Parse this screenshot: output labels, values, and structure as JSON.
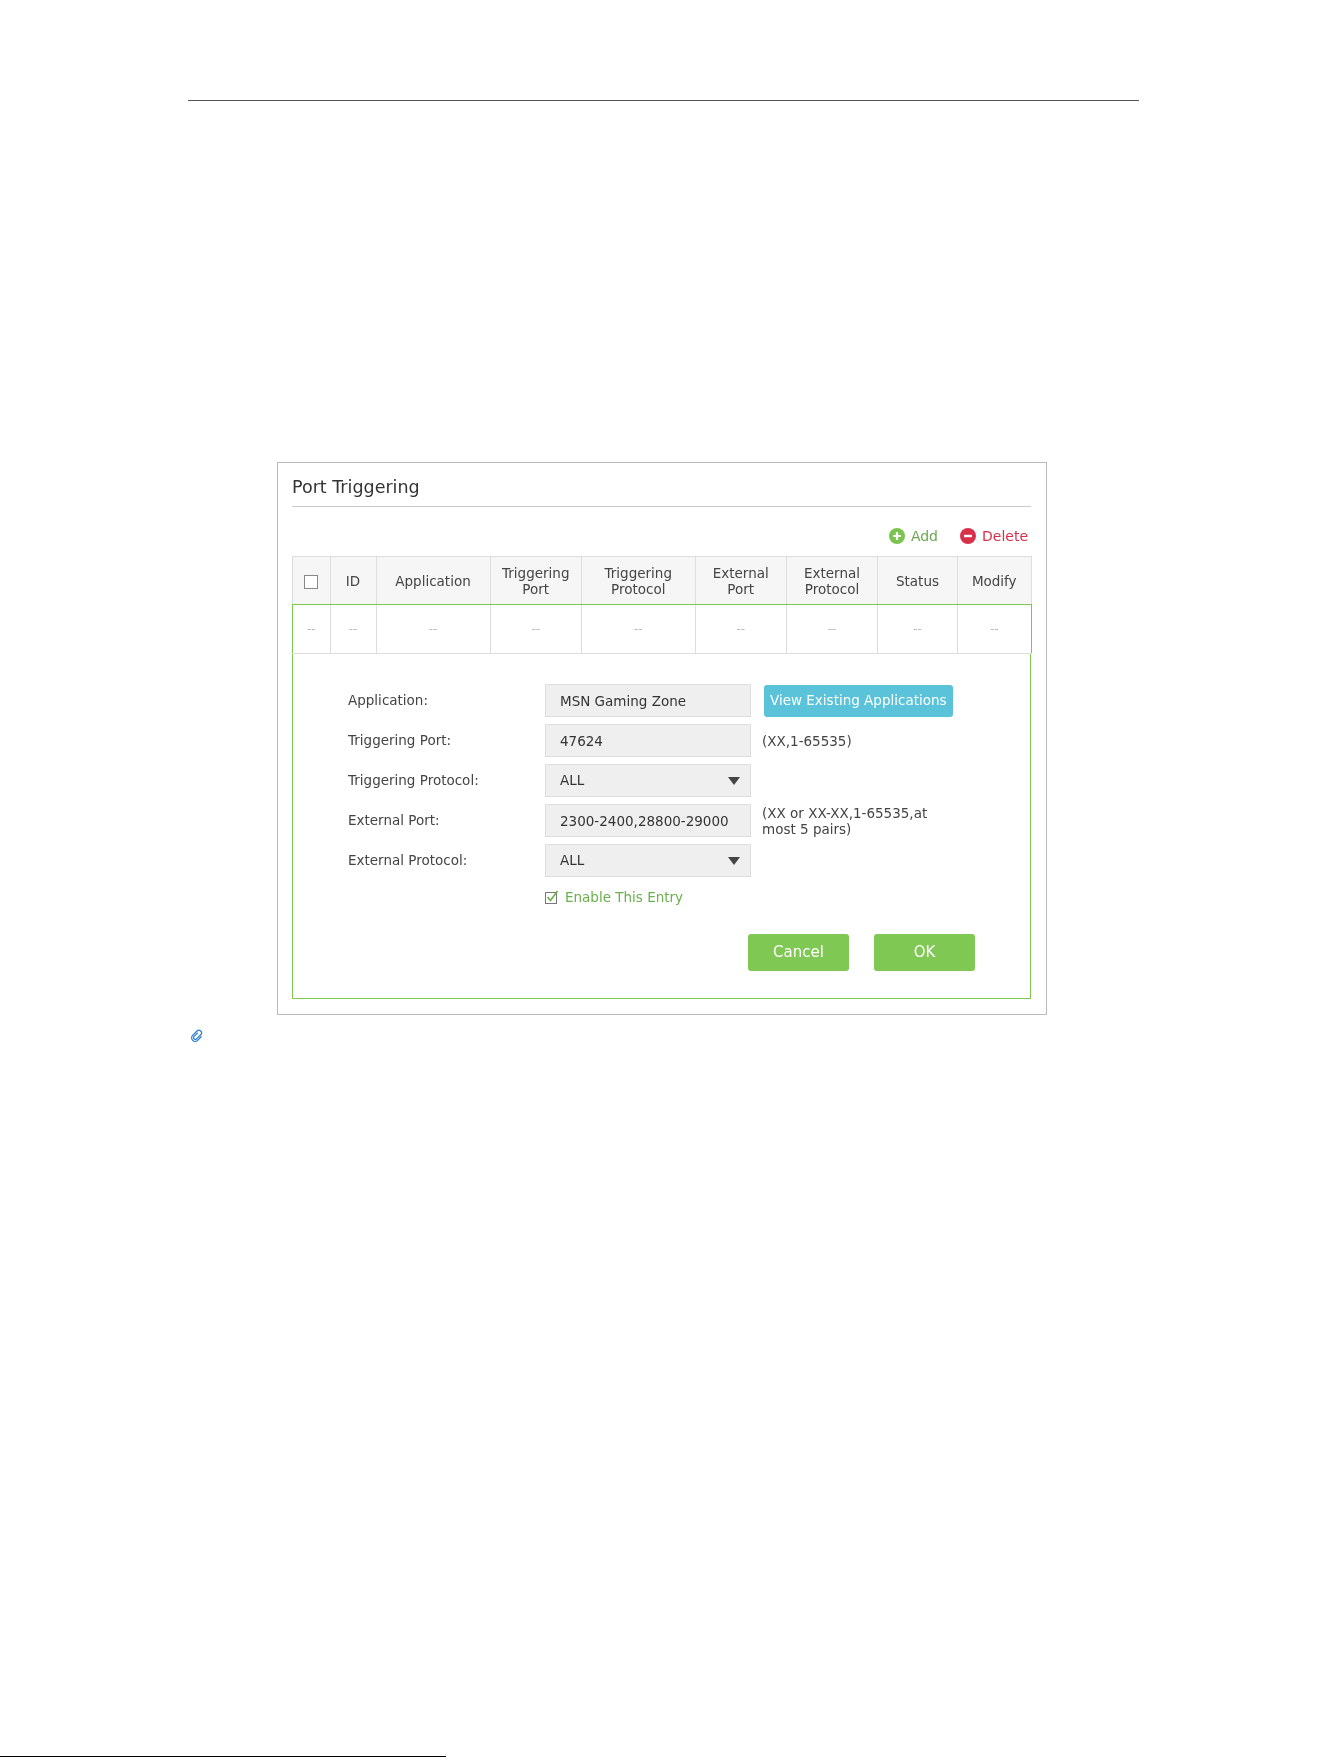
{
  "panel": {
    "title": "Port Triggering"
  },
  "toolbar": [
    {
      "kind": "add",
      "label": "Add"
    },
    {
      "kind": "delete",
      "label": "Delete"
    }
  ],
  "table": {
    "columns": [
      {
        "kind": "checkbox",
        "checked": false
      },
      {
        "kind": "label",
        "label": "ID"
      },
      {
        "kind": "label",
        "label": "Application"
      },
      {
        "kind": "label",
        "label": "Triggering Port"
      },
      {
        "kind": "label",
        "label": "Triggering Protocol"
      },
      {
        "kind": "label",
        "label": "External Port"
      },
      {
        "kind": "label",
        "label": "External Protocol"
      },
      {
        "kind": "label",
        "label": "Status"
      },
      {
        "kind": "label",
        "label": "Modify"
      }
    ],
    "rows": [
      {
        "cells": [
          "--",
          "--",
          "--",
          "--",
          "--",
          "--",
          "--",
          "--",
          "--"
        ]
      }
    ]
  },
  "form": {
    "fields": [
      {
        "kind": "text",
        "label": "Application:",
        "value": "MSN Gaming Zone",
        "button": "View Existing Applications"
      },
      {
        "kind": "text",
        "label": "Triggering Port:",
        "value": "47624",
        "hint": "(XX,1-65535)"
      },
      {
        "kind": "select",
        "label": "Triggering Protocol:",
        "value": "ALL"
      },
      {
        "kind": "text",
        "label": "External Port:",
        "value": "2300-2400,28800-29000",
        "hint": "(XX or XX-XX,1-65535,at most 5 pairs)"
      },
      {
        "kind": "select",
        "label": "External Protocol:",
        "value": "ALL"
      }
    ],
    "enable": {
      "label": "Enable This Entry",
      "checked": true
    },
    "buttons": [
      {
        "label": "Cancel"
      },
      {
        "label": "OK"
      }
    ]
  }
}
